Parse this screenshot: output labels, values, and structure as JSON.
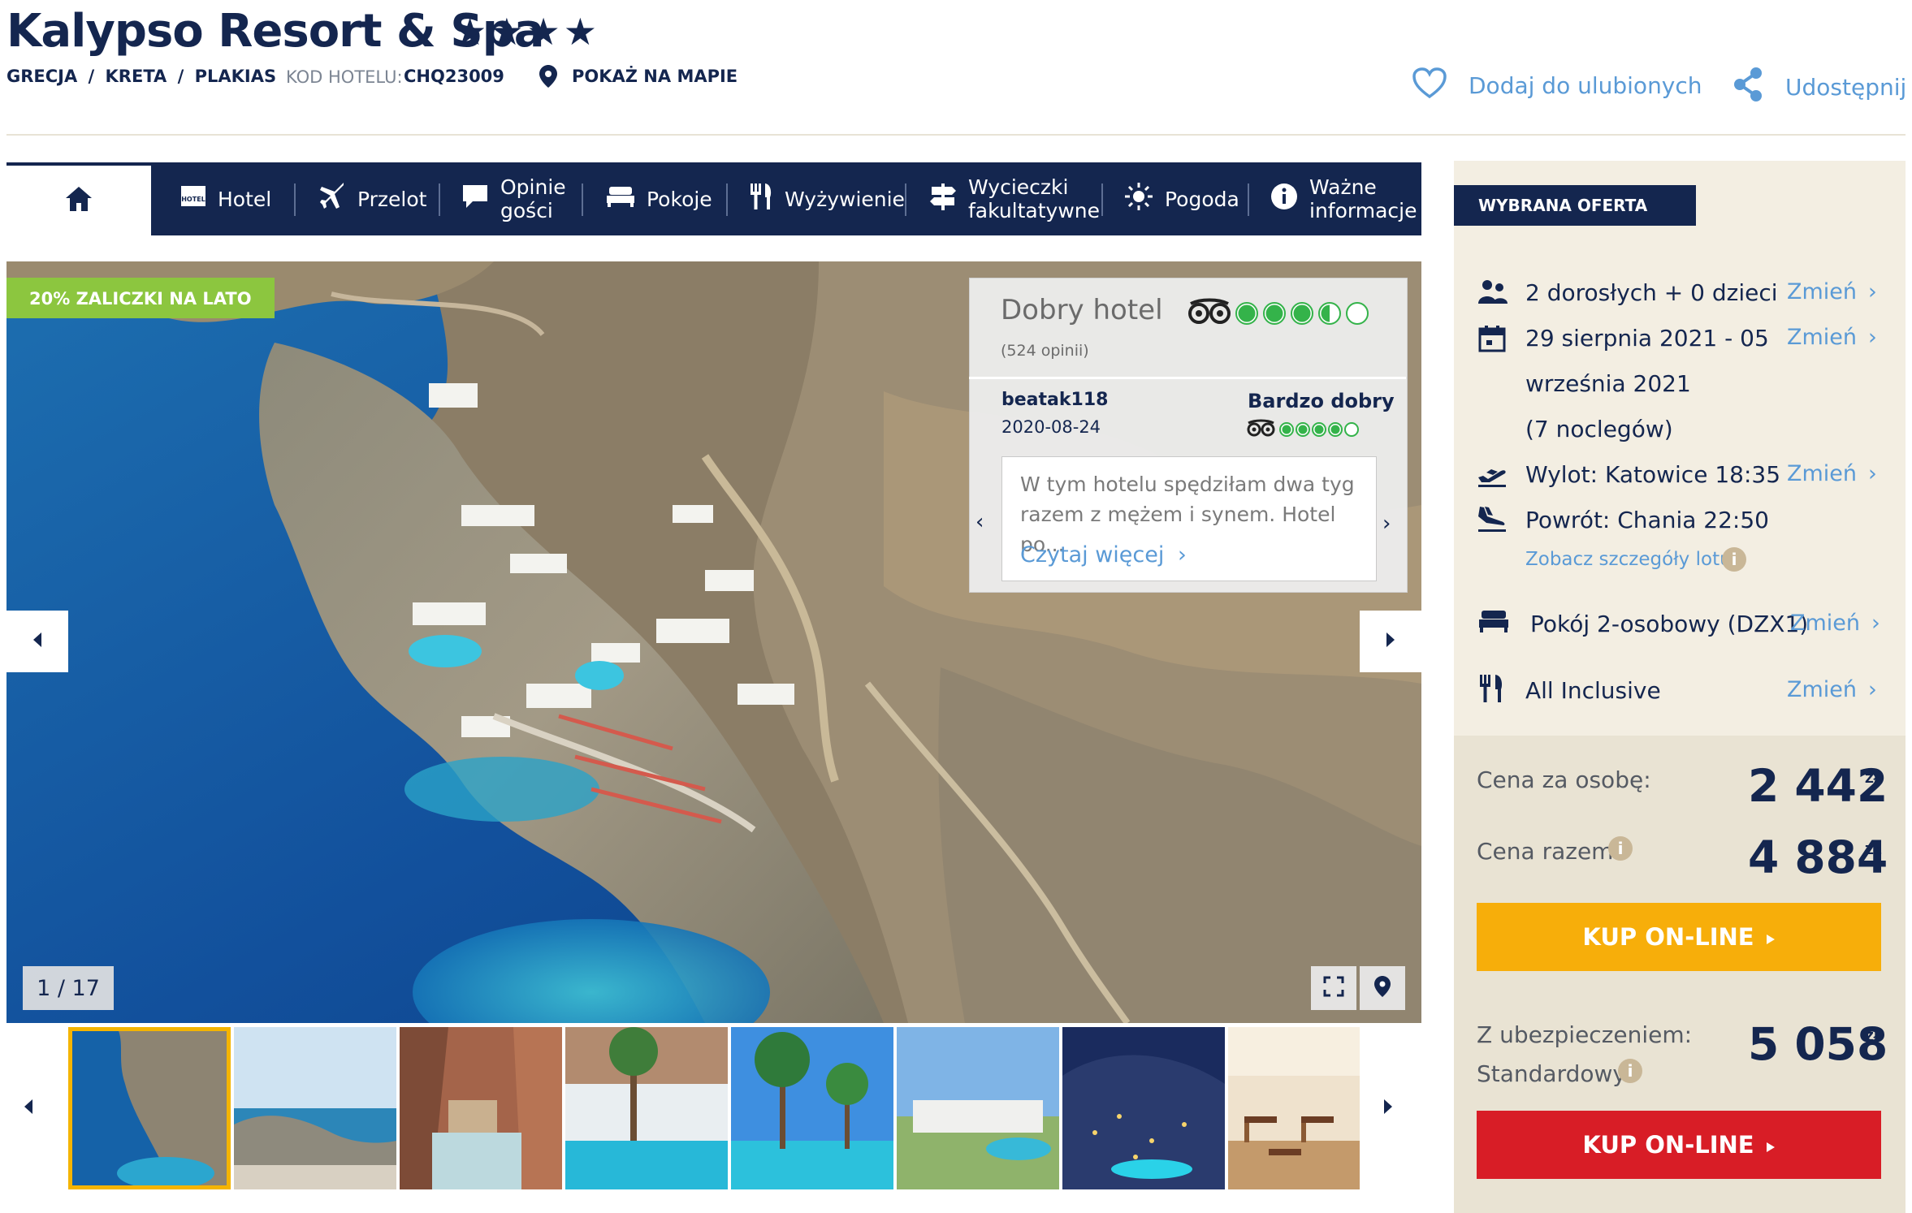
{
  "hotel": {
    "name": "Kalypso Resort & Spa",
    "stars": "★★★★",
    "location": [
      "GRECJA",
      "/",
      "KRETA",
      "/",
      "PLAKIAS"
    ],
    "code_label": "KOD HOTELU:",
    "code_value": "CHQ23009",
    "map_link": "POKAŻ NA MAPIE",
    "favorite": "Dodaj do ulubionych",
    "share": "Udostępnij"
  },
  "nav": {
    "items": [
      {
        "label": "Hotel",
        "icon": "hotel-icon"
      },
      {
        "label": "Przelot",
        "icon": "plane-icon"
      },
      {
        "label": "Opinie\ngości",
        "icon": "chat-icon"
      },
      {
        "label": "Pokoje",
        "icon": "bed-icon"
      },
      {
        "label": "Wyżywienie",
        "icon": "cutlery-icon"
      },
      {
        "label": "Wycieczki\nfakultatywne",
        "icon": "signpost-icon"
      },
      {
        "label": "Pogoda",
        "icon": "sun-icon"
      },
      {
        "label": "Ważne\ninformacje",
        "icon": "info-icon"
      }
    ]
  },
  "gallery": {
    "badge": "20% ZALICZKI NA LATO",
    "counter": "1 / 17"
  },
  "review": {
    "title": "Dobry hotel",
    "count": "(524 opinii)",
    "rating_bubbles": 3.5,
    "user": "beatak118",
    "date": "2020-08-24",
    "verdict": "Bardzo dobry",
    "user_bubbles": 4,
    "text": "W tym hotelu spędziłam dwa tyg razem z mężem i synem. Hotel po...",
    "more": "Czytaj więcej"
  },
  "offer": {
    "tab": "WYBRANA OFERTA",
    "guests": "2 dorosłych + 0 dzieci",
    "dates_line1": "29 sierpnia 2021 - 05",
    "dates_line2": "września 2021",
    "nights": "(7 noclegów)",
    "departure": "Wylot: Katowice 18:35",
    "return": "Powrót: Chania 22:50",
    "flight_details": "Zobacz szczegóły lotu",
    "room": "Pokój 2-osobowy (DZX1)",
    "board": "All Inclusive",
    "change": "Zmień",
    "price_per_person_label": "Cena za osobę:",
    "price_per_person": "2 442",
    "price_total_label": "Cena razem:",
    "price_total": "4 884",
    "currency": "ZŁ",
    "buy_label": "KUP ON-LINE",
    "insurance_label1": "Z ubezpieczeniem:",
    "insurance_label2": "Standardowy",
    "price_insured": "5 058",
    "info_glyph": "i"
  },
  "colors": {
    "navy": "#14264f",
    "link_blue": "#5a9ad6",
    "badge_green": "#8cc63f",
    "tripadvisor_green": "#34b34a",
    "buy_yellow": "#f7ae0a",
    "buy_red": "#d81d26",
    "panel_bg": "#f3eee2"
  }
}
